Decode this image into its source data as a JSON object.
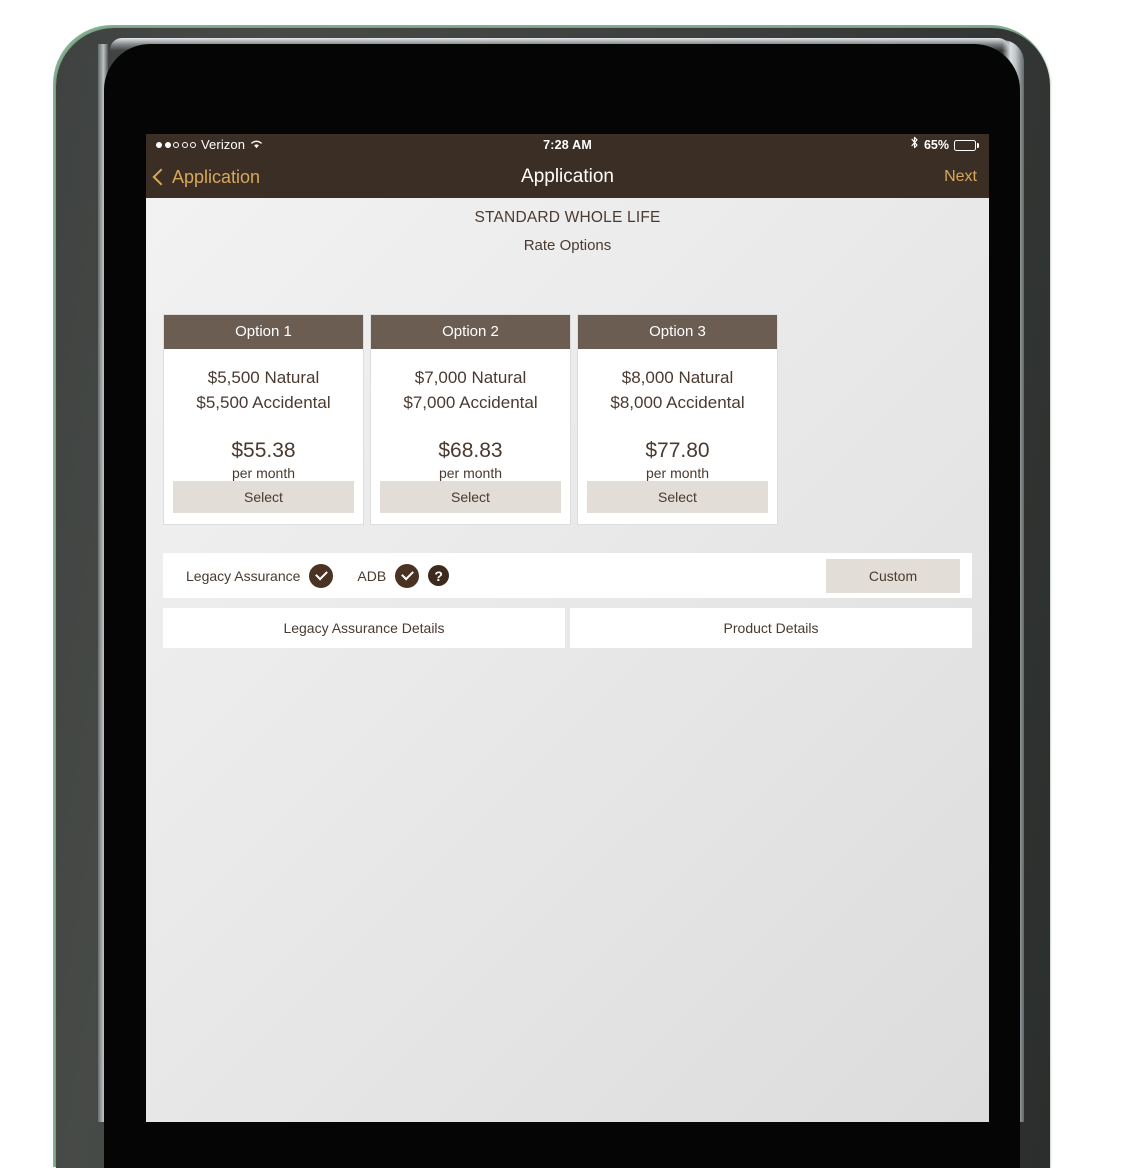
{
  "status_bar": {
    "carrier": "Verizon",
    "signal_dots_filled": 2,
    "signal_dots_total": 5,
    "wifi_icon": "wifi-icon",
    "time": "7:28 AM",
    "bluetooth_icon": "bluetooth-icon",
    "battery_percent_label": "65%",
    "battery_percent_value": 65
  },
  "nav_bar": {
    "back_label": "Application",
    "back_icon": "chevron-left-icon",
    "title": "Application",
    "next_label": "Next",
    "background_color": "#3a2e25",
    "accent_color": "#d8a85a"
  },
  "page": {
    "heading": "STANDARD WHOLE LIFE",
    "subheading": "Rate Options"
  },
  "rate_options": [
    {
      "header": "Option 1",
      "natural": "$5,500 Natural",
      "accidental": "$5,500 Accidental",
      "price": "$55.38",
      "period": "per month",
      "select_label": "Select"
    },
    {
      "header": "Option 2",
      "natural": "$7,000 Natural",
      "accidental": "$7,000 Accidental",
      "price": "$68.83",
      "period": "per month",
      "select_label": "Select"
    },
    {
      "header": "Option 3",
      "natural": "$8,000 Natural",
      "accidental": "$8,000 Accidental",
      "price": "$77.80",
      "period": "per month",
      "select_label": "Select"
    }
  ],
  "riders": {
    "legacy_assurance_label": "Legacy Assurance",
    "legacy_assurance_state_icon": "check-circle-icon",
    "adb_label": "ADB",
    "adb_state_icon": "check-circle-icon",
    "help_icon": "question-mark-circle-icon",
    "help_label": "?",
    "custom_label": "Custom"
  },
  "details_buttons": {
    "legacy_details_label": "Legacy Assurance Details",
    "product_details_label": "Product Details"
  },
  "theme": {
    "card_header_brown": "#6b5d52",
    "nav_brown": "#3a2e25",
    "badge_brown": "#4a3323",
    "text_brown": "#4a3a30",
    "button_beige": "#e2ddd6"
  }
}
